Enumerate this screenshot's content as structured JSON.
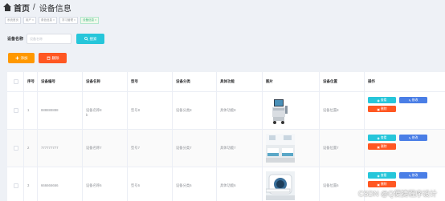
{
  "header": {
    "home_label": "首页",
    "separator": "/",
    "page_title": "设备信息"
  },
  "tags": [
    {
      "label": "系统首页",
      "active": false
    },
    {
      "label": "用户 ×",
      "active": false
    },
    {
      "label": "角色信息 ×",
      "active": false
    },
    {
      "label": "学习管理 ×",
      "active": false
    },
    {
      "label": "设备信息 ×",
      "active": true
    }
  ],
  "search": {
    "label": "设备名称",
    "placeholder": "设备名称",
    "button_label": "搜索"
  },
  "toolbar": {
    "add_label": "添加",
    "delete_label": "删除"
  },
  "table": {
    "columns": [
      "序号",
      "设备编号",
      "设备名称",
      "型号",
      "设备分类",
      "具体功能",
      "图片",
      "设备位置",
      "操作"
    ],
    "rows": [
      {
        "index": "1",
        "code": "888888888",
        "name": "设备名称8",
        "name_extra": "b",
        "model": "型号8",
        "category": "设备分类8",
        "function": "具体功能8",
        "image": "medical-cart-image",
        "location": "设备位置8"
      },
      {
        "index": "2",
        "code": "777777777",
        "name": "设备名称7",
        "name_extra": "",
        "model": "型号7",
        "category": "设备分类7",
        "function": "具体功能7",
        "image": "ward-room-image",
        "location": "设备位置7"
      },
      {
        "index": "3",
        "code": "666666666",
        "name": "设备名称6",
        "name_extra": "",
        "model": "型号6",
        "category": "设备分类6",
        "function": "具体功能6",
        "image": "mri-scanner-image",
        "location": "设备位置6"
      }
    ],
    "actions": {
      "view": "查看",
      "edit": "修改",
      "delete": "删除"
    }
  },
  "watermark": "CSDN @Q便捷程序设计",
  "colors": {
    "search_btn": "#26c6da",
    "add_btn": "#ff9800",
    "delete_btn": "#ff5722",
    "edit_btn": "#4a7ee6",
    "active_tag": "#42b983"
  }
}
